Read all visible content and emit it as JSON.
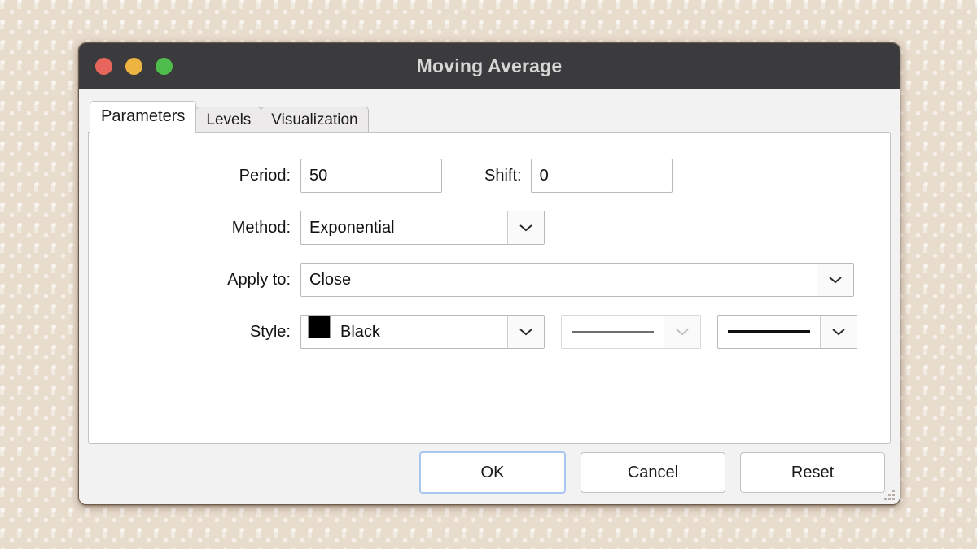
{
  "window": {
    "title": "Moving Average",
    "controls": [
      {
        "name": "close",
        "color": "#e7655c"
      },
      {
        "name": "minimize",
        "color": "#edb442"
      },
      {
        "name": "maximize",
        "color": "#4fbd4c"
      }
    ],
    "titlebar_color": "#3b3b3d",
    "body_color": "#f2f2f2"
  },
  "tabs": [
    {
      "label": "Parameters",
      "active": true
    },
    {
      "label": "Levels",
      "active": false
    },
    {
      "label": "Visualization",
      "active": false
    }
  ],
  "form": {
    "period": {
      "label": "Period:",
      "value": "50"
    },
    "shift": {
      "label": "Shift:",
      "value": "0"
    },
    "method": {
      "label": "Method:",
      "value": "Exponential"
    },
    "apply_to": {
      "label": "Apply to:",
      "value": "Close"
    },
    "style": {
      "label": "Style:",
      "color_name": "Black",
      "color_hex": "#000000",
      "line_style_preview": "solid-thin",
      "line_width_preview": "solid-thick"
    }
  },
  "footer": {
    "ok": "OK",
    "cancel": "Cancel",
    "reset": "Reset",
    "focus_color": "#a8c7f0"
  }
}
